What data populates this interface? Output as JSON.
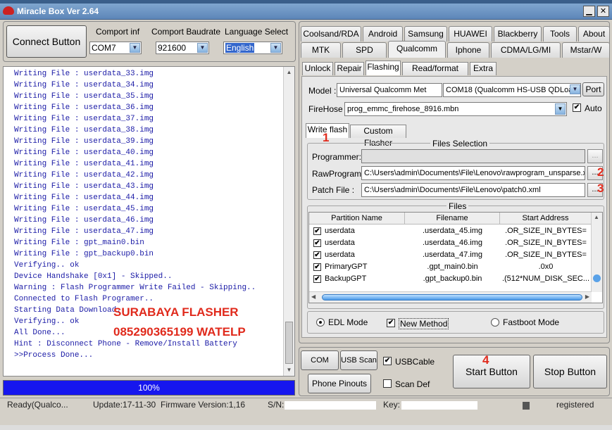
{
  "window": {
    "title": "Miracle Box Ver 2.64"
  },
  "connect": {
    "button": "Connect Button",
    "comport_label": "Comport inf",
    "comport_value": "COM7",
    "baud_label": "Comport Baudrate",
    "baud_value": "921600",
    "lang_label": "Language Select",
    "lang_value": "English"
  },
  "log": {
    "lines": [
      "Writing File : userdata_33.img",
      "Writing File : userdata_34.img",
      "Writing File : userdata_35.img",
      "Writing File : userdata_36.img",
      "Writing File : userdata_37.img",
      "Writing File : userdata_38.img",
      "Writing File : userdata_39.img",
      "Writing File : userdata_40.img",
      "Writing File : userdata_41.img",
      "Writing File : userdata_42.img",
      "Writing File : userdata_43.img",
      "Writing File : userdata_44.img",
      "Writing File : userdata_45.img",
      "Writing File : userdata_46.img",
      "Writing File : userdata_47.img",
      "Writing File : gpt_main0.bin",
      "Writing File : gpt_backup0.bin",
      "Verifying.. ok",
      "Device Handshake [0x1] - Skipped..",
      "Warning : Flash Programmer Write Failed - Skipping..",
      "Connected to Flash Programer..",
      "Starting Data Download..",
      "Verifying.. ok",
      "All Done...",
      "Hint : Disconnect Phone - Remove/Install Battery",
      ">>Process Done..."
    ],
    "watermark1": "SURABAYA FLASHER",
    "watermark2": "085290365199 WATELP"
  },
  "progress": {
    "label": "100%",
    "value": 1.0
  },
  "status": {
    "state": "Ready(Qualco...",
    "update": "Update:17-11-30",
    "firmware": "Firmware Version:1,16",
    "sn_label": "S/N:",
    "key_label": "Key:",
    "registered": "registered"
  },
  "brand_tabs_row1": [
    "Coolsand/RDA",
    "Android",
    "Samsung",
    "HUAWEI",
    "Blackberry",
    "Tools",
    "About"
  ],
  "brand_tabs_row2": [
    "MTK",
    "SPD",
    "Qualcomm",
    "Iphone",
    "CDMA/LG/MI",
    "Mstar/W"
  ],
  "func_tabs": [
    "Unlock",
    "Repair",
    "Flashing",
    "Read/format flash",
    "Extra"
  ],
  "model": {
    "label": "Model :",
    "value": "Universal Qualcomm Met",
    "port_value": "COM18 (Qualcomm HS-USB QDLoad",
    "port_button": "Port"
  },
  "firehose": {
    "label": "FireHose :",
    "value": "prog_emmc_firehose_8916.mbn",
    "auto_label": "Auto"
  },
  "flash_tabs": [
    "Write flash",
    "Custom Flasher"
  ],
  "files_selection": {
    "title": "Files Selection",
    "programmer_label": "Programmer:",
    "programmer_value": "",
    "rawprogram_label": "RawProgram :",
    "rawprogram_value": "C:\\Users\\admin\\Documents\\File\\Lenovo\\rawprogram_unsparse.xml",
    "patch_label": "Patch File :",
    "patch_value": "C:\\Users\\admin\\Documents\\File\\Lenovo\\patch0.xml",
    "browse": "..."
  },
  "annotations": [
    "1",
    "2",
    "3",
    "4"
  ],
  "files": {
    "title": "Files",
    "columns": [
      "Partition Name",
      "Filename",
      "Start Address"
    ],
    "rows": [
      {
        "name": "userdata",
        "file": ".userdata_45.img",
        "addr": ".OR_SIZE_IN_BYTES="
      },
      {
        "name": "userdata",
        "file": ".userdata_46.img",
        "addr": ".OR_SIZE_IN_BYTES="
      },
      {
        "name": "userdata",
        "file": ".userdata_47.img",
        "addr": ".OR_SIZE_IN_BYTES="
      },
      {
        "name": "PrimaryGPT",
        "file": ".gpt_main0.bin",
        "addr": ".0x0"
      },
      {
        "name": "BackupGPT",
        "file": ".gpt_backup0.bin",
        "addr": ".(512*NUM_DISK_SEC..."
      }
    ]
  },
  "modes": {
    "edl": "EDL Mode",
    "new_method": "New Method",
    "fastboot": "Fastboot Mode"
  },
  "bottom": {
    "com_scan": "COM Scan",
    "usb_scan": "USB Scan",
    "usb_cable": "USBCable",
    "phone_pinouts": "Phone Pinouts",
    "scan_def": "Scan Def",
    "start": "Start Button",
    "stop": "Stop Button"
  }
}
